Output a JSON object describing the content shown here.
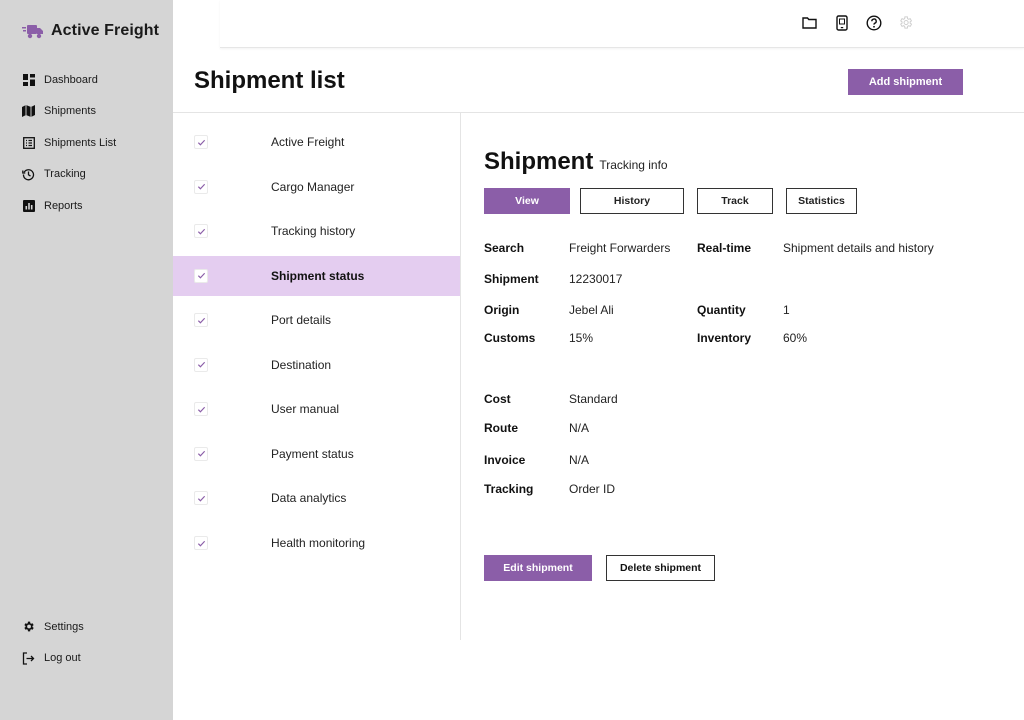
{
  "brand": {
    "name": "Active Freight",
    "icon": "truck-icon",
    "icon_color": "#8b5ea8"
  },
  "sidebar": {
    "items": [
      {
        "label": "Dashboard",
        "icon": "dashboard-icon"
      },
      {
        "label": "Shipments",
        "icon": "map-icon"
      },
      {
        "label": "Shipments List",
        "icon": "list-icon"
      },
      {
        "label": "Tracking",
        "icon": "history-icon"
      },
      {
        "label": "Reports",
        "icon": "report-icon"
      }
    ],
    "bottom": [
      {
        "label": "Settings",
        "icon": "gear-icon"
      },
      {
        "label": "Log out",
        "icon": "logout-icon"
      }
    ]
  },
  "topbar": {
    "icons": [
      "folder-icon",
      "phone-icon",
      "help-icon",
      "settings-icon"
    ]
  },
  "page": {
    "title": "Shipment list",
    "add_button": "Add shipment"
  },
  "list": {
    "selected": "Shipment status",
    "items": [
      "Active Freight",
      "Cargo Manager",
      "Tracking history",
      "Shipment status",
      "Port details",
      "Destination",
      "User manual",
      "Payment status",
      "Data analytics",
      "Health monitoring"
    ]
  },
  "detail": {
    "title": "Shipment",
    "subtitle": "Tracking info",
    "tabs": [
      "View",
      "History",
      "Track",
      "Statistics"
    ],
    "active_tab": "View",
    "fields": {
      "search": {
        "label": "Search",
        "value": "Freight Forwarders"
      },
      "realtime": {
        "label": "Real-time",
        "value": "Shipment details and history"
      },
      "shipment": {
        "label": "Shipment",
        "value": "12230017"
      },
      "origin": {
        "label": "Origin",
        "value": "Jebel Ali"
      },
      "quantity": {
        "label": "Quantity",
        "value": "1"
      },
      "customs": {
        "label": "Customs",
        "value": "15%"
      },
      "inventory": {
        "label": "Inventory",
        "value": "60%"
      },
      "cost": {
        "label": "Cost",
        "value": "Standard"
      },
      "route": {
        "label": "Route",
        "value": "N/A"
      },
      "invoice": {
        "label": "Invoice",
        "value": "N/A"
      },
      "tracking": {
        "label": "Tracking",
        "value": "Order ID"
      }
    },
    "edit_button": "Edit shipment",
    "delete_button": "Delete shipment"
  },
  "colors": {
    "accent": "#8b5ea8",
    "selected_row": "#e4cdf0",
    "sidebar_bg": "#d5d5d5"
  }
}
